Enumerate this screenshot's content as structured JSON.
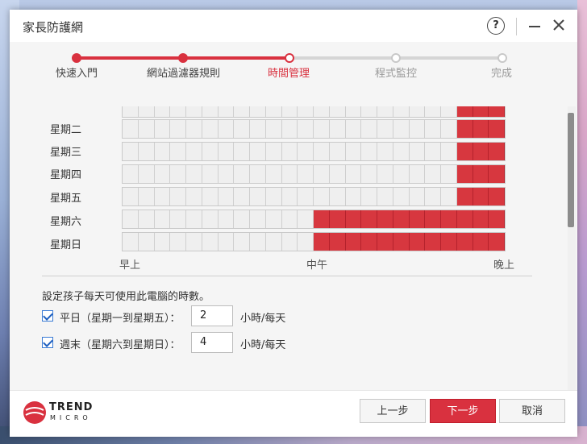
{
  "window": {
    "title": "家長防護網"
  },
  "steps": [
    {
      "label": "快速入門",
      "state": "done"
    },
    {
      "label": "網站過濾器規則",
      "state": "done"
    },
    {
      "label": "時間管理",
      "state": "active"
    },
    {
      "label": "程式監控",
      "state": "pending"
    },
    {
      "label": "完成",
      "state": "pending"
    }
  ],
  "schedule": {
    "days": [
      {
        "label": "",
        "allowed_hours": "21-24"
      },
      {
        "label": "星期二",
        "allowed_hours": "21-24"
      },
      {
        "label": "星期三",
        "allowed_hours": "21-24"
      },
      {
        "label": "星期四",
        "allowed_hours": "21-24"
      },
      {
        "label": "星期五",
        "allowed_hours": "21-24"
      },
      {
        "label": "星期六",
        "allowed_hours": "12-24"
      },
      {
        "label": "星期日",
        "allowed_hours": "12-24"
      }
    ],
    "ticks": {
      "start": "早上",
      "mid": "中午",
      "end": "晚上"
    }
  },
  "usage": {
    "instruction": "設定孩子每天可使用此電腦的時數。",
    "weekday": {
      "label": "平日（星期一到星期五）：",
      "value": "2",
      "unit": "小時/每天",
      "checked": true
    },
    "weekend": {
      "label": "週末（星期六到星期日）：",
      "value": "4",
      "unit": "小時/每天",
      "checked": true
    }
  },
  "footer": {
    "logo_line1": "TREND",
    "logo_line2": "MICRO",
    "prev_label": "上一步",
    "next_label": "下一步",
    "cancel_label": "取消"
  },
  "colors": {
    "accent": "#d9313f",
    "pending": "#c8c8c8"
  }
}
